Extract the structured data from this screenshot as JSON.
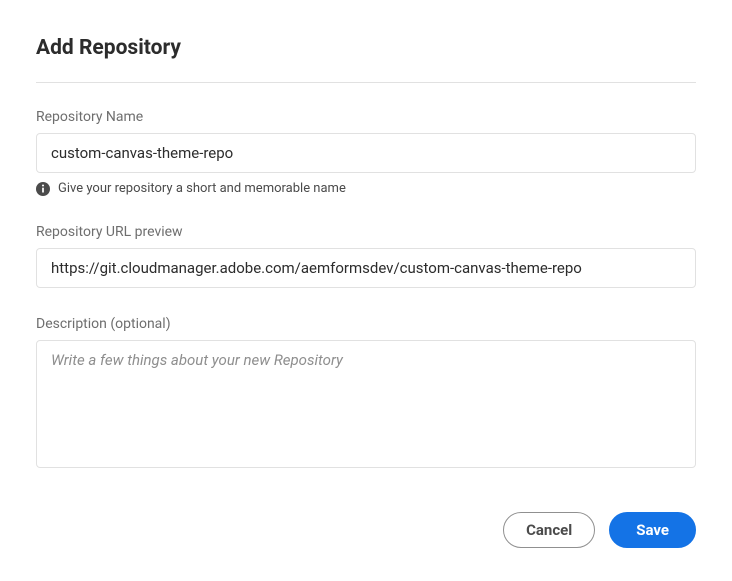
{
  "dialog": {
    "title": "Add Repository"
  },
  "fields": {
    "name": {
      "label": "Repository Name",
      "value": "custom-canvas-theme-repo",
      "hint": "Give your repository a short and memorable name"
    },
    "url_preview": {
      "label": "Repository URL preview",
      "value": "https://git.cloudmanager.adobe.com/aemformsdev/custom-canvas-theme-repo"
    },
    "description": {
      "label": "Description (optional)",
      "value": "",
      "placeholder": "Write a few things about your new Repository"
    }
  },
  "buttons": {
    "cancel": "Cancel",
    "save": "Save"
  }
}
